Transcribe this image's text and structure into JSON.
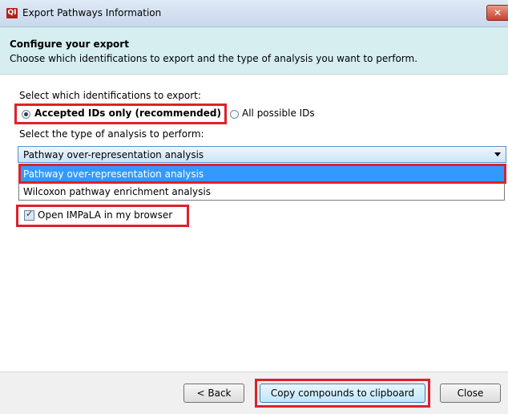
{
  "window": {
    "title": "Export Pathways Information",
    "app_icon": "QI",
    "close_glyph": "✕"
  },
  "header": {
    "title": "Configure your export",
    "subtitle": "Choose which identifications to export and the type of analysis you want to perform."
  },
  "identifications": {
    "prompt": "Select which identifications to export:",
    "options": [
      {
        "label": "Accepted IDs only (recommended)",
        "selected": true
      },
      {
        "label": "All possible IDs",
        "selected": false
      }
    ]
  },
  "analysis": {
    "prompt": "Select the type of analysis to perform:",
    "selected": "Pathway over-representation analysis",
    "options": [
      {
        "label": "Pathway over-representation analysis",
        "highlighted": true
      },
      {
        "label": "Wilcoxon pathway enrichment analysis",
        "highlighted": false
      }
    ]
  },
  "open_browser": {
    "label": "Open IMPaLA in my browser",
    "checked": true
  },
  "footer": {
    "back_label": "< Back",
    "copy_label": "Copy compounds to clipboard",
    "close_label": "Close"
  },
  "colors": {
    "highlight_box": "#e0202a",
    "header_bg": "#d6eef0",
    "selection": "#3399ff"
  }
}
